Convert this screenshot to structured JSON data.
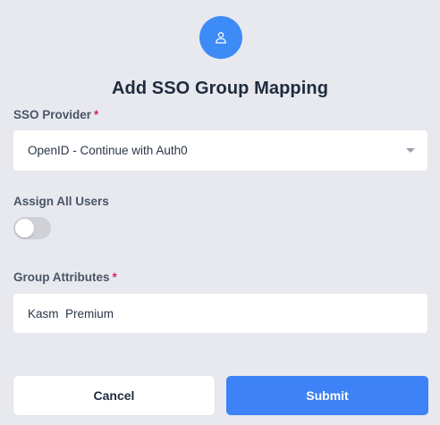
{
  "header": {
    "icon": "user-icon",
    "accent_color": "#3d8bf7",
    "title": "Add SSO Group Mapping"
  },
  "form": {
    "sso_provider": {
      "label": "SSO Provider",
      "required_mark": "*",
      "value": "OpenID - Continue with Auth0"
    },
    "assign_all_users": {
      "label": "Assign All Users",
      "checked": false
    },
    "group_attributes": {
      "label": "Group Attributes",
      "required_mark": "*",
      "value": "Kasm  Premium"
    }
  },
  "actions": {
    "cancel_label": "Cancel",
    "submit_label": "Submit",
    "submit_color": "#3d82f6"
  }
}
